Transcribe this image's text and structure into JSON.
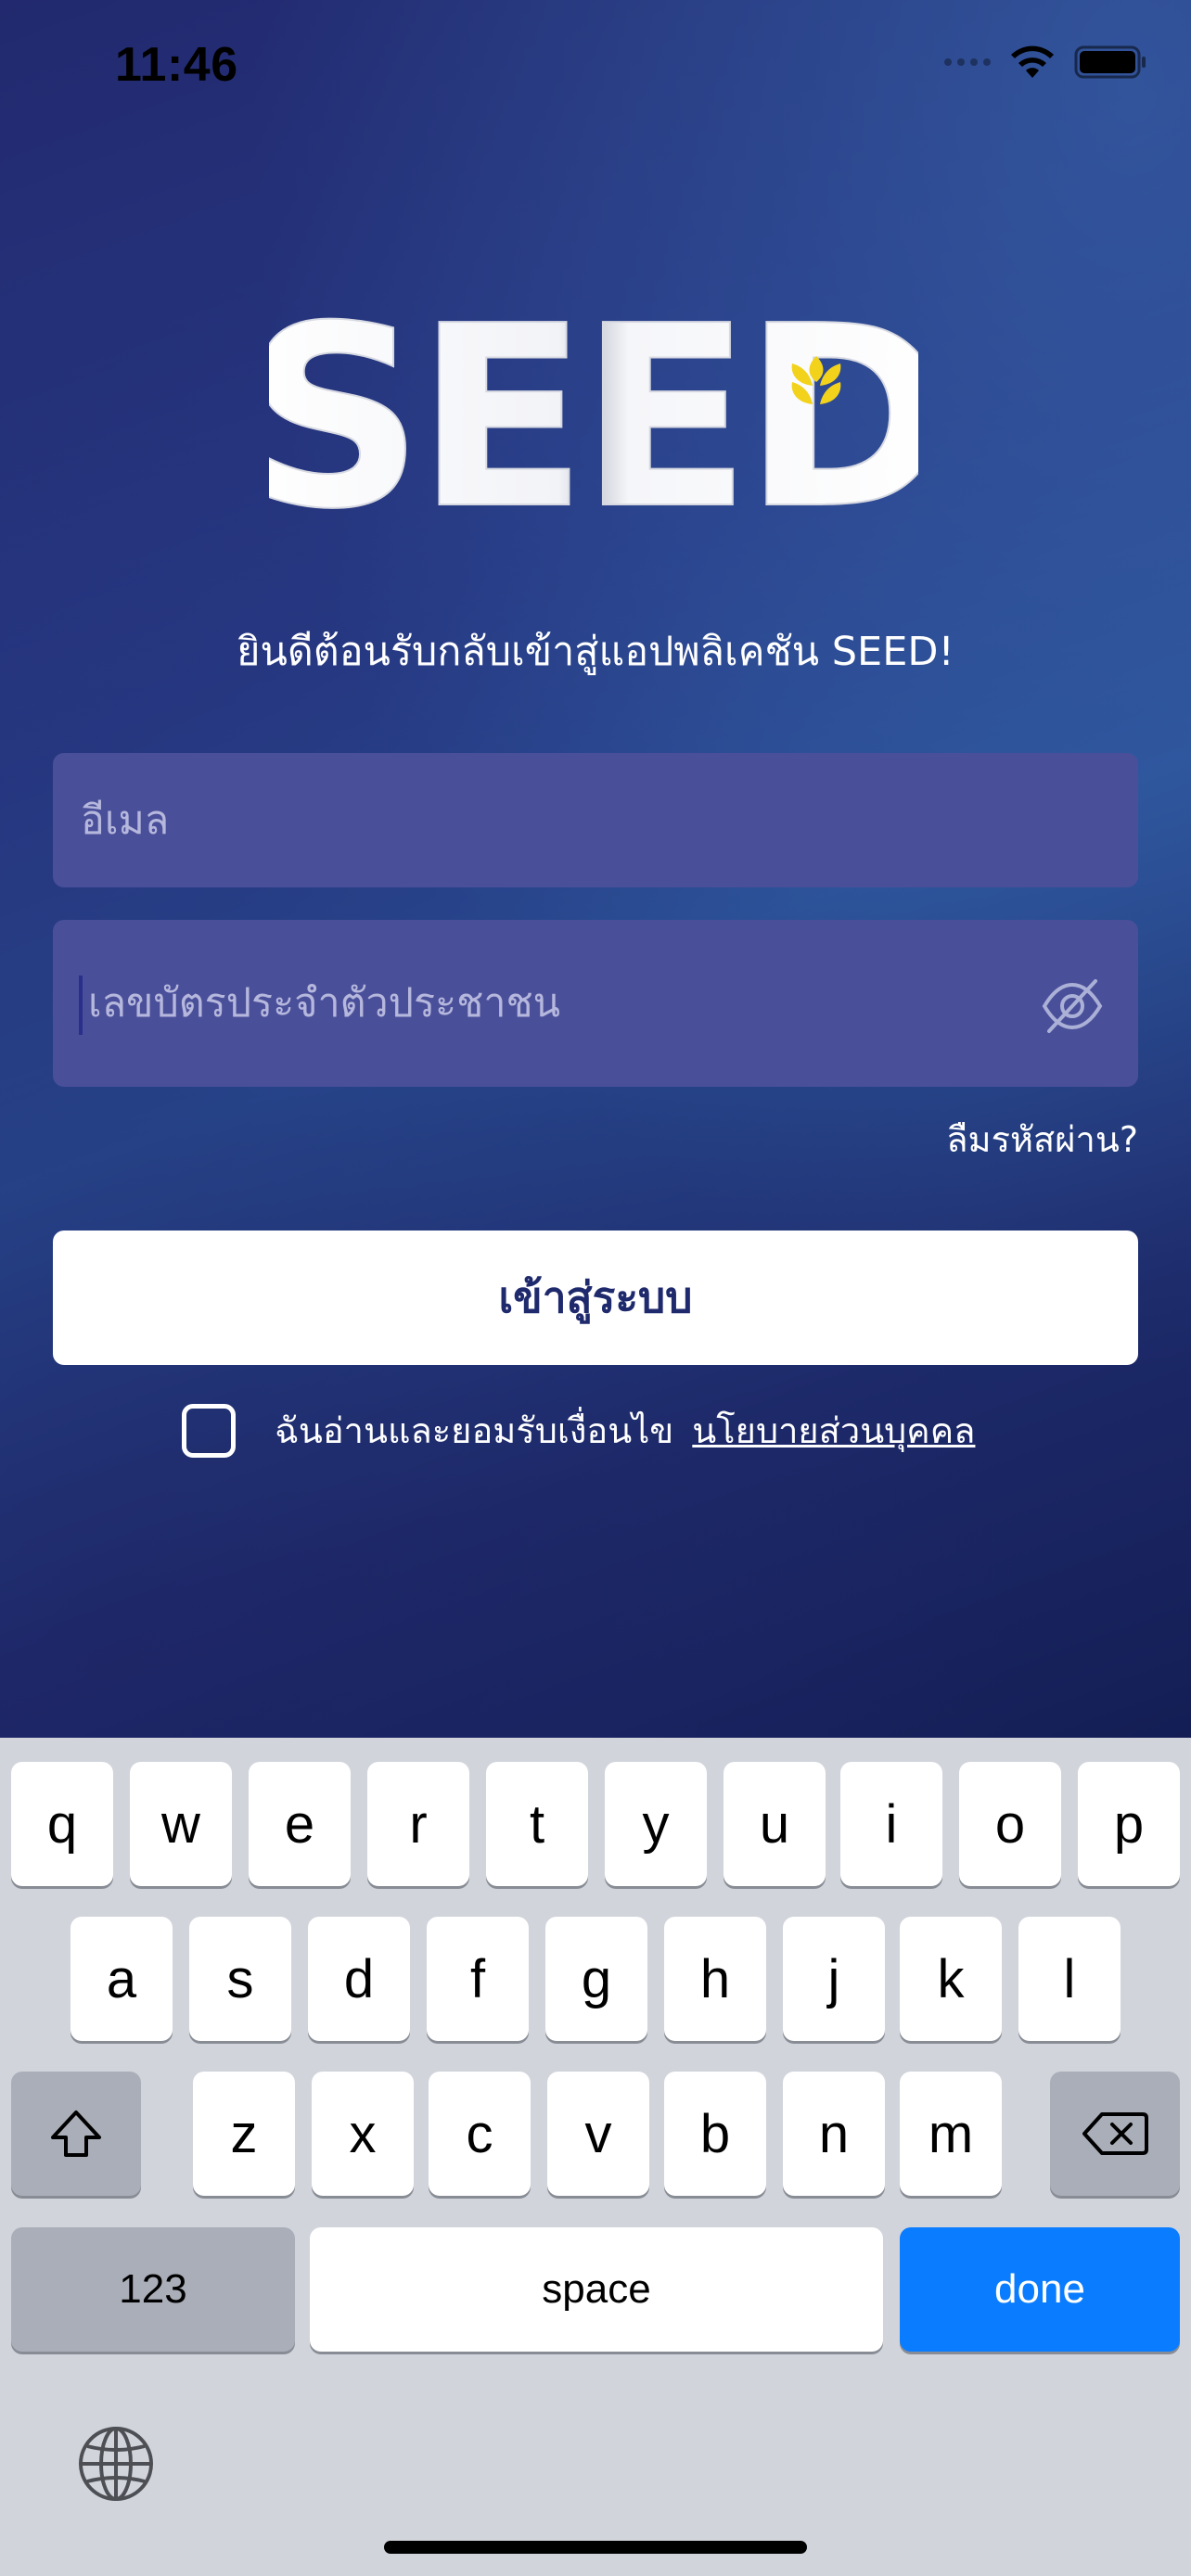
{
  "status_bar": {
    "time": "11:46"
  },
  "logo": {
    "text": "SEED"
  },
  "welcome_text": "ยินดีต้อนรับกลับเข้าสู่แอปพลิเคชัน SEED!",
  "form": {
    "email_placeholder": "อีเมล",
    "id_placeholder": "เลขบัตรประจำตัวประชาชน",
    "forgot_password": "ลืมรหัสผ่าน?",
    "login_button": "เข้าสู่ระบบ",
    "consent_text": "ฉันอ่านและยอมรับเงื่อนไข",
    "consent_link": "นโยบายส่วนบุคคล",
    "consent_checked": false
  },
  "keyboard": {
    "row1": [
      "q",
      "w",
      "e",
      "r",
      "t",
      "y",
      "u",
      "i",
      "o",
      "p"
    ],
    "row2": [
      "a",
      "s",
      "d",
      "f",
      "g",
      "h",
      "j",
      "k",
      "l"
    ],
    "row3": [
      "z",
      "x",
      "c",
      "v",
      "b",
      "n",
      "m"
    ],
    "numbers_key": "123",
    "space_key": "space",
    "done_key": "done"
  },
  "colors": {
    "accent_done": "#0a7cff",
    "button_text": "#1f2a6d",
    "logo_leaf": "#f2d21b"
  }
}
